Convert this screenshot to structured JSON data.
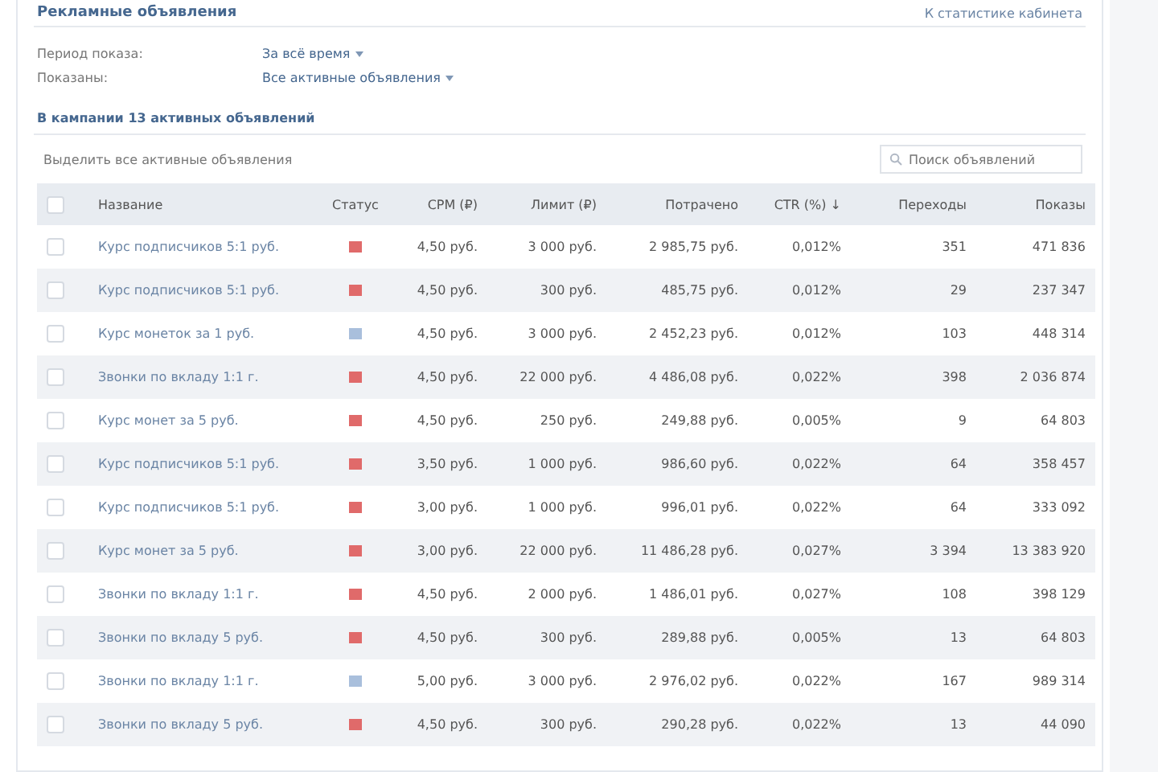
{
  "header": {
    "title": "Рекламные объявления",
    "link": "К статистике кабинета"
  },
  "filters": [
    {
      "label": "Период показа:",
      "value": "За всё время"
    },
    {
      "label": "Показаны:",
      "value": "Все активные объявления"
    }
  ],
  "section_title": "В кампании 13 активных объявлений",
  "select_all_link": "Выделить все активные объявления",
  "search": {
    "placeholder": "Поиск объявлений"
  },
  "table": {
    "all_checked": false,
    "columns": [
      "Название",
      "Статус",
      "CPM (₽)",
      "Лимит (₽)",
      "Потрачено",
      "CTR (%) ↓",
      "Переходы",
      "Показы"
    ],
    "rows": [
      {
        "checked": false,
        "name": "Курс подписчиков 5:1 руб.",
        "color": "#e06a6a",
        "cpm": "4,50 руб.",
        "limit": "3 000 руб.",
        "spent": "2 985,75 руб.",
        "ctr": "0,012%",
        "clicks": "351",
        "impressions": "471 836"
      },
      {
        "checked": false,
        "name": "Курс подписчиков 5:1 руб.",
        "color": "#e06a6a",
        "cpm": "4,50 руб.",
        "limit": "300 руб.",
        "spent": "485,75 руб.",
        "ctr": "0,012%",
        "clicks": "29",
        "impressions": "237 347"
      },
      {
        "checked": false,
        "name": "Курс монеток за 1 руб.",
        "color": "#a9bfdc",
        "cpm": "4,50 руб.",
        "limit": "3 000 руб.",
        "spent": "2 452,23 руб.",
        "ctr": "0,012%",
        "clicks": "103",
        "impressions": "448 314"
      },
      {
        "checked": false,
        "name": "Звонки по вкладу 1:1 г.",
        "color": "#e06a6a",
        "cpm": "4,50 руб.",
        "limit": "22 000 руб.",
        "spent": "4 486,08 руб.",
        "ctr": "0,022%",
        "clicks": "398",
        "impressions": "2 036 874"
      },
      {
        "checked": false,
        "name": "Курс монет за 5 руб.",
        "color": "#e06a6a",
        "cpm": "4,50 руб.",
        "limit": "250 руб.",
        "spent": "249,88 руб.",
        "ctr": "0,005%",
        "clicks": "9",
        "impressions": "64 803"
      },
      {
        "checked": false,
        "name": "Курс подписчиков 5:1 руб.",
        "color": "#e06a6a",
        "cpm": "3,50 руб.",
        "limit": "1 000 руб.",
        "spent": "986,60 руб.",
        "ctr": "0,022%",
        "clicks": "64",
        "impressions": "358 457"
      },
      {
        "checked": false,
        "name": "Курс подписчиков 5:1 руб.",
        "color": "#e06a6a",
        "cpm": "3,00 руб.",
        "limit": "1 000 руб.",
        "spent": "996,01 руб.",
        "ctr": "0,022%",
        "clicks": "64",
        "impressions": "333 092"
      },
      {
        "checked": false,
        "name": "Курс монет за 5 руб.",
        "color": "#e06a6a",
        "cpm": "3,00 руб.",
        "limit": "22 000 руб.",
        "spent": "11 486,28 руб.",
        "ctr": "0,027%",
        "clicks": "3 394",
        "impressions": "13 383 920"
      },
      {
        "checked": false,
        "name": "Звонки по вкладу 1:1 г.",
        "color": "#e06a6a",
        "cpm": "4,50 руб.",
        "limit": "2 000 руб.",
        "spent": "1 486,01 руб.",
        "ctr": "0,027%",
        "clicks": "108",
        "impressions": "398 129"
      },
      {
        "checked": false,
        "name": "Звонки по вкладу 5 руб.",
        "color": "#e06a6a",
        "cpm": "4,50 руб.",
        "limit": "300 руб.",
        "spent": "289,88 руб.",
        "ctr": "0,005%",
        "clicks": "13",
        "impressions": "64 803"
      },
      {
        "checked": false,
        "name": "Звонки по вкладу 1:1 г.",
        "color": "#a9bfdc",
        "cpm": "5,00 руб.",
        "limit": "3 000 руб.",
        "spent": "2 976,02 руб.",
        "ctr": "0,022%",
        "clicks": "167",
        "impressions": "989 314"
      },
      {
        "checked": false,
        "name": "Звонки по вкладу 5 руб.",
        "color": "#e06a6a",
        "cpm": "4,50 руб.",
        "limit": "300 руб.",
        "spent": "290,28 руб.",
        "ctr": "0,022%",
        "clicks": "13",
        "impressions": "44 090"
      }
    ]
  }
}
